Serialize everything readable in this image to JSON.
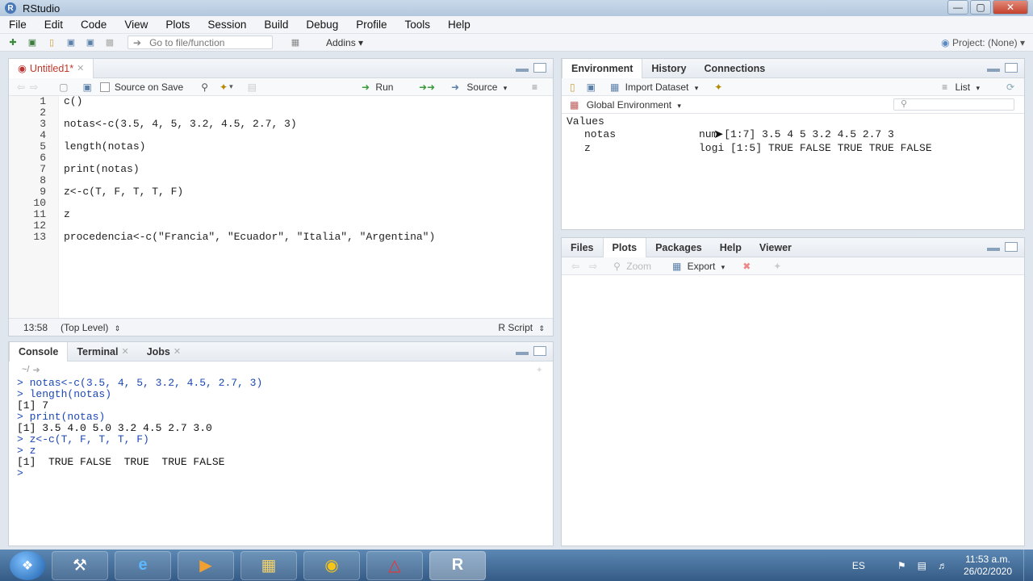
{
  "window": {
    "title": "RStudio"
  },
  "menu": [
    "File",
    "Edit",
    "Code",
    "View",
    "Plots",
    "Session",
    "Build",
    "Debug",
    "Profile",
    "Tools",
    "Help"
  ],
  "toolbar": {
    "goto_placeholder": "Go to file/function",
    "addins": "Addins",
    "project": "Project: (None)"
  },
  "editor": {
    "tab": "Untitled1*",
    "source_on_save": "Source on Save",
    "run": "Run",
    "source": "Source",
    "lines": [
      {
        "n": "1",
        "code": "c()"
      },
      {
        "n": "2",
        "code": ""
      },
      {
        "n": "3",
        "code": "notas<-c(3.5, 4, 5, 3.2, 4.5, 2.7, 3)"
      },
      {
        "n": "4",
        "code": ""
      },
      {
        "n": "5",
        "code": "length(notas)"
      },
      {
        "n": "6",
        "code": ""
      },
      {
        "n": "7",
        "code": "print(notas)"
      },
      {
        "n": "8",
        "code": ""
      },
      {
        "n": "9",
        "code": "z<-c(T, F, T, T, F)"
      },
      {
        "n": "10",
        "code": ""
      },
      {
        "n": "11",
        "code": "z"
      },
      {
        "n": "12",
        "code": ""
      },
      {
        "n": "13",
        "code": "procedencia<-c(\"Francia\", \"Ecuador\", \"Italia\", \"Argentina\")"
      }
    ],
    "status_pos": "13:58",
    "status_level": "(Top Level)",
    "status_type": "R Script"
  },
  "console": {
    "tabs": [
      "Console",
      "Terminal",
      "Jobs"
    ],
    "path": "~/",
    "lines": [
      {
        "type": "cmd",
        "text": "> notas<-c(3.5, 4, 5, 3.2, 4.5, 2.7, 3)"
      },
      {
        "type": "cmd",
        "text": "> length(notas)"
      },
      {
        "type": "out",
        "text": "[1] 7"
      },
      {
        "type": "cmd",
        "text": "> print(notas)"
      },
      {
        "type": "out",
        "text": "[1] 3.5 4.0 5.0 3.2 4.5 2.7 3.0"
      },
      {
        "type": "cmd",
        "text": "> z<-c(T, F, T, T, F)"
      },
      {
        "type": "cmd",
        "text": "> z"
      },
      {
        "type": "out",
        "text": "[1]  TRUE FALSE  TRUE  TRUE FALSE"
      },
      {
        "type": "cmd",
        "text": "> "
      }
    ]
  },
  "environment": {
    "tabs": [
      "Environment",
      "History",
      "Connections"
    ],
    "import": "Import Dataset",
    "list": "List",
    "scope": "Global Environment",
    "section": "Values",
    "rows": [
      {
        "name": "notas",
        "value": "num [1:7] 3.5 4 5 3.2 4.5 2.7 3"
      },
      {
        "name": "z",
        "value": "logi [1:5] TRUE FALSE TRUE TRUE FALSE"
      }
    ]
  },
  "files": {
    "tabs": [
      "Files",
      "Plots",
      "Packages",
      "Help",
      "Viewer"
    ],
    "zoom": "Zoom",
    "export": "Export"
  },
  "taskbar": {
    "lang": "ES",
    "time": "11:53 a.m.",
    "date": "26/02/2020"
  }
}
